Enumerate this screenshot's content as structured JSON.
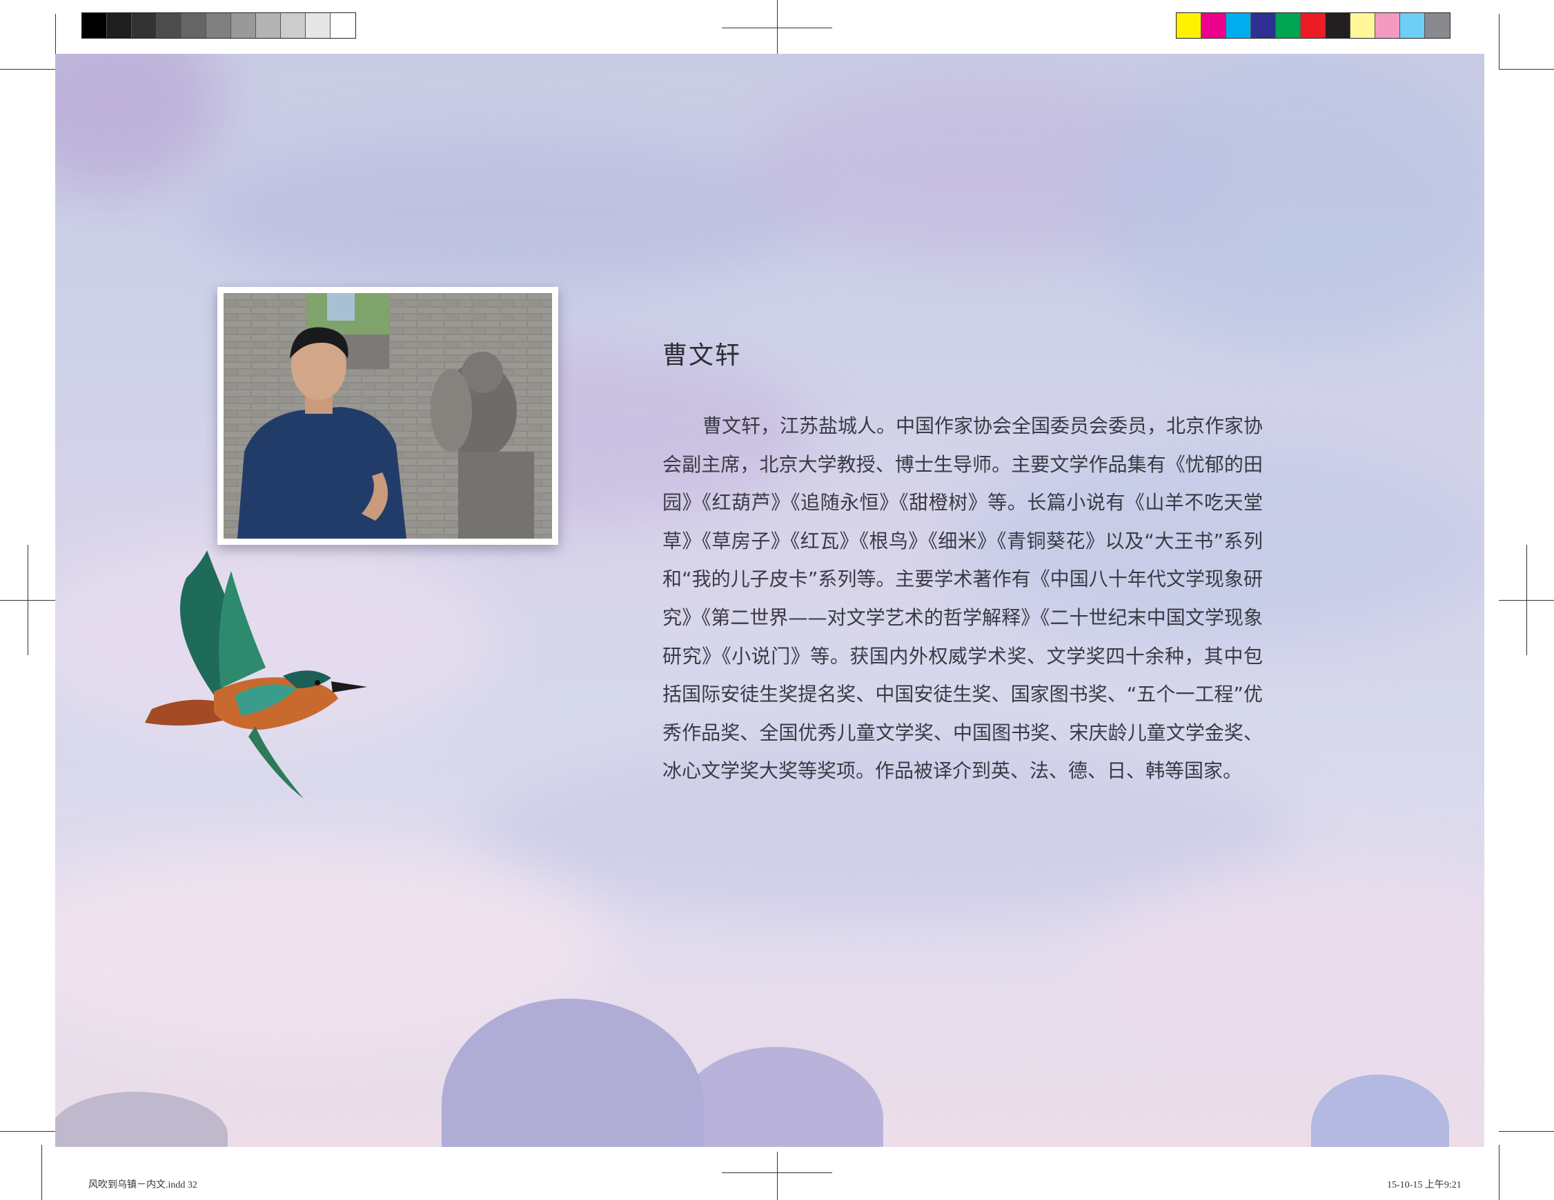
{
  "print_marks": {
    "gray_swatches": [
      "#000000",
      "#1e1e1e",
      "#333333",
      "#4d4d4d",
      "#666666",
      "#808080",
      "#999999",
      "#b3b3b3",
      "#cccccc",
      "#e6e6e6",
      "#ffffff"
    ],
    "color_swatches": [
      "#fff200",
      "#ec008c",
      "#00aeef",
      "#2e3192",
      "#00a651",
      "#ed1c24",
      "#231f20",
      "#fff799",
      "#f49ac1",
      "#6dcff6",
      "#898a8d"
    ]
  },
  "author": {
    "name": "曹文轩",
    "bio": "曹文轩，江苏盐城人。中国作家协会全国委员会委员，北京作家协会副主席，北京大学教授、博士生导师。主要文学作品集有《忧郁的田园》《红葫芦》《追随永恒》《甜橙树》等。长篇小说有《山羊不吃天堂草》《草房子》《红瓦》《根鸟》《细米》《青铜葵花》以及“大王书”系列和“我的儿子皮卡”系列等。主要学术著作有《中国八十年代文学现象研究》《第二世界——对文学艺术的哲学解释》《二十世纪末中国文学现象研究》《小说门》等。获国内外权威学术奖、文学奖四十余种，其中包括国际安徒生奖提名奖、中国安徒生奖、国家图书奖、“五个一工程”优秀作品奖、全国优秀儿童文学奖、中国图书奖、宋庆龄儿童文学金奖、冰心文学奖大奖等奖项。作品被译介到英、法、德、日、韩等国家。"
  },
  "footer": {
    "file_info": "风吹到乌镇－内文.indd   32",
    "timestamp": "15-10-15   上午9:21"
  }
}
